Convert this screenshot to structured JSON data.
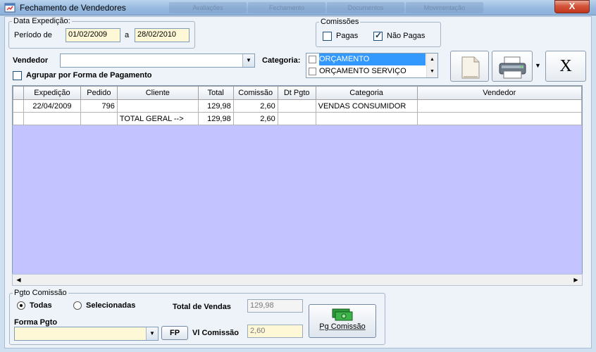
{
  "window": {
    "title": "Fechamento de Vendedores",
    "close_label": "X"
  },
  "background_tabs": [
    "Avaliações",
    "Fechamento",
    "Documentos",
    "Movimentação"
  ],
  "data_expedicao": {
    "legend": "Data Expedição:",
    "periodo_label": "Período de",
    "from": "01/02/2009",
    "sep": "a",
    "to": "28/02/2010"
  },
  "comissoes": {
    "legend": "Comissões",
    "pagas_label": "Pagas",
    "pagas_checked": false,
    "nao_pagas_label": "Não Pagas",
    "nao_pagas_checked": true
  },
  "filters": {
    "vendedor_label": "Vendedor",
    "vendedor_value": "",
    "categoria_label": "Categoria:",
    "categorias": [
      {
        "label": "ORÇAMENTO",
        "selected": true
      },
      {
        "label": "ORÇAMENTO SERVIÇO",
        "selected": false
      }
    ],
    "agrupar_label": "Agrupar por Forma de Pagamento"
  },
  "toolbar": {
    "new_icon": "document-icon",
    "print_icon": "printer-icon",
    "close_icon": "close-icon",
    "close_glyph": "X"
  },
  "grid": {
    "columns": [
      "Expedição",
      "Pedido",
      "Cliente",
      "Total",
      "Comissão",
      "Dt Pgto",
      "Categoria",
      "Vendedor"
    ],
    "rows": [
      [
        "22/04/2009",
        "796",
        "",
        "129,98",
        "2,60",
        "",
        "VENDAS CONSUMIDOR",
        ""
      ],
      [
        "",
        "",
        "TOTAL GERAL -->",
        "129,98",
        "2,60",
        "",
        "",
        ""
      ]
    ]
  },
  "pgto": {
    "legend": "Pgto Comissão",
    "todas_label": "Todas",
    "selecionadas_label": "Selecionadas",
    "forma_label": "Forma Pgto",
    "forma_value": "",
    "fp_label": "FP",
    "total_vendas_label": "Total de Vendas",
    "total_vendas_value": "129,98",
    "vl_comissao_label": "Vl Comissão",
    "vl_comissao_value": "2,60",
    "pg_comissao_label": "Pg Comissão"
  },
  "colors": {
    "grid_bg": "#c3c3ff",
    "date_field": "#fff8d6",
    "selection": "#3399ff"
  }
}
